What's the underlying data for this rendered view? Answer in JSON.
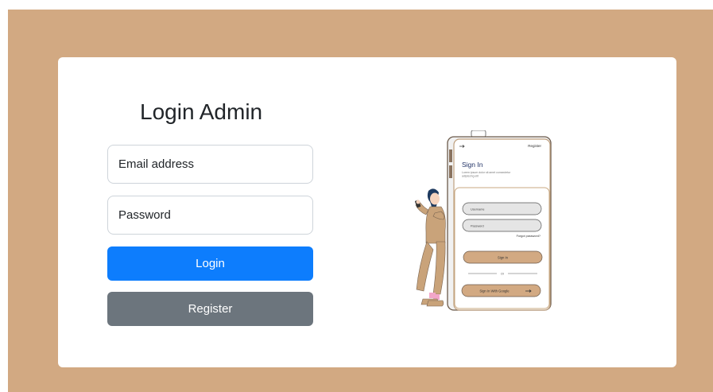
{
  "page": {
    "title": "Login Admin",
    "email_placeholder": "Email address",
    "password_placeholder": "Password",
    "login_label": "Login",
    "register_label": "Register"
  },
  "illustration": {
    "register_link": "Register",
    "heading": "Sign In",
    "subtext_line1": "Lorem ipsum dolor sit amet consectetur",
    "subtext_line2": "adipiscing elit",
    "username_placeholder": "Username",
    "password_placeholder": "Password",
    "forgot_link": "Forgot password?",
    "signin_label": "Sign In",
    "or_label": "Or",
    "google_label": "Sign In With Google"
  },
  "colors": {
    "background": "#d2a982",
    "primary": "#0d7dfd",
    "secondary": "#6c757d",
    "card": "#ffffff"
  },
  "icons": {
    "back": "arrow-left-icon",
    "google": "arrow-right-icon"
  }
}
